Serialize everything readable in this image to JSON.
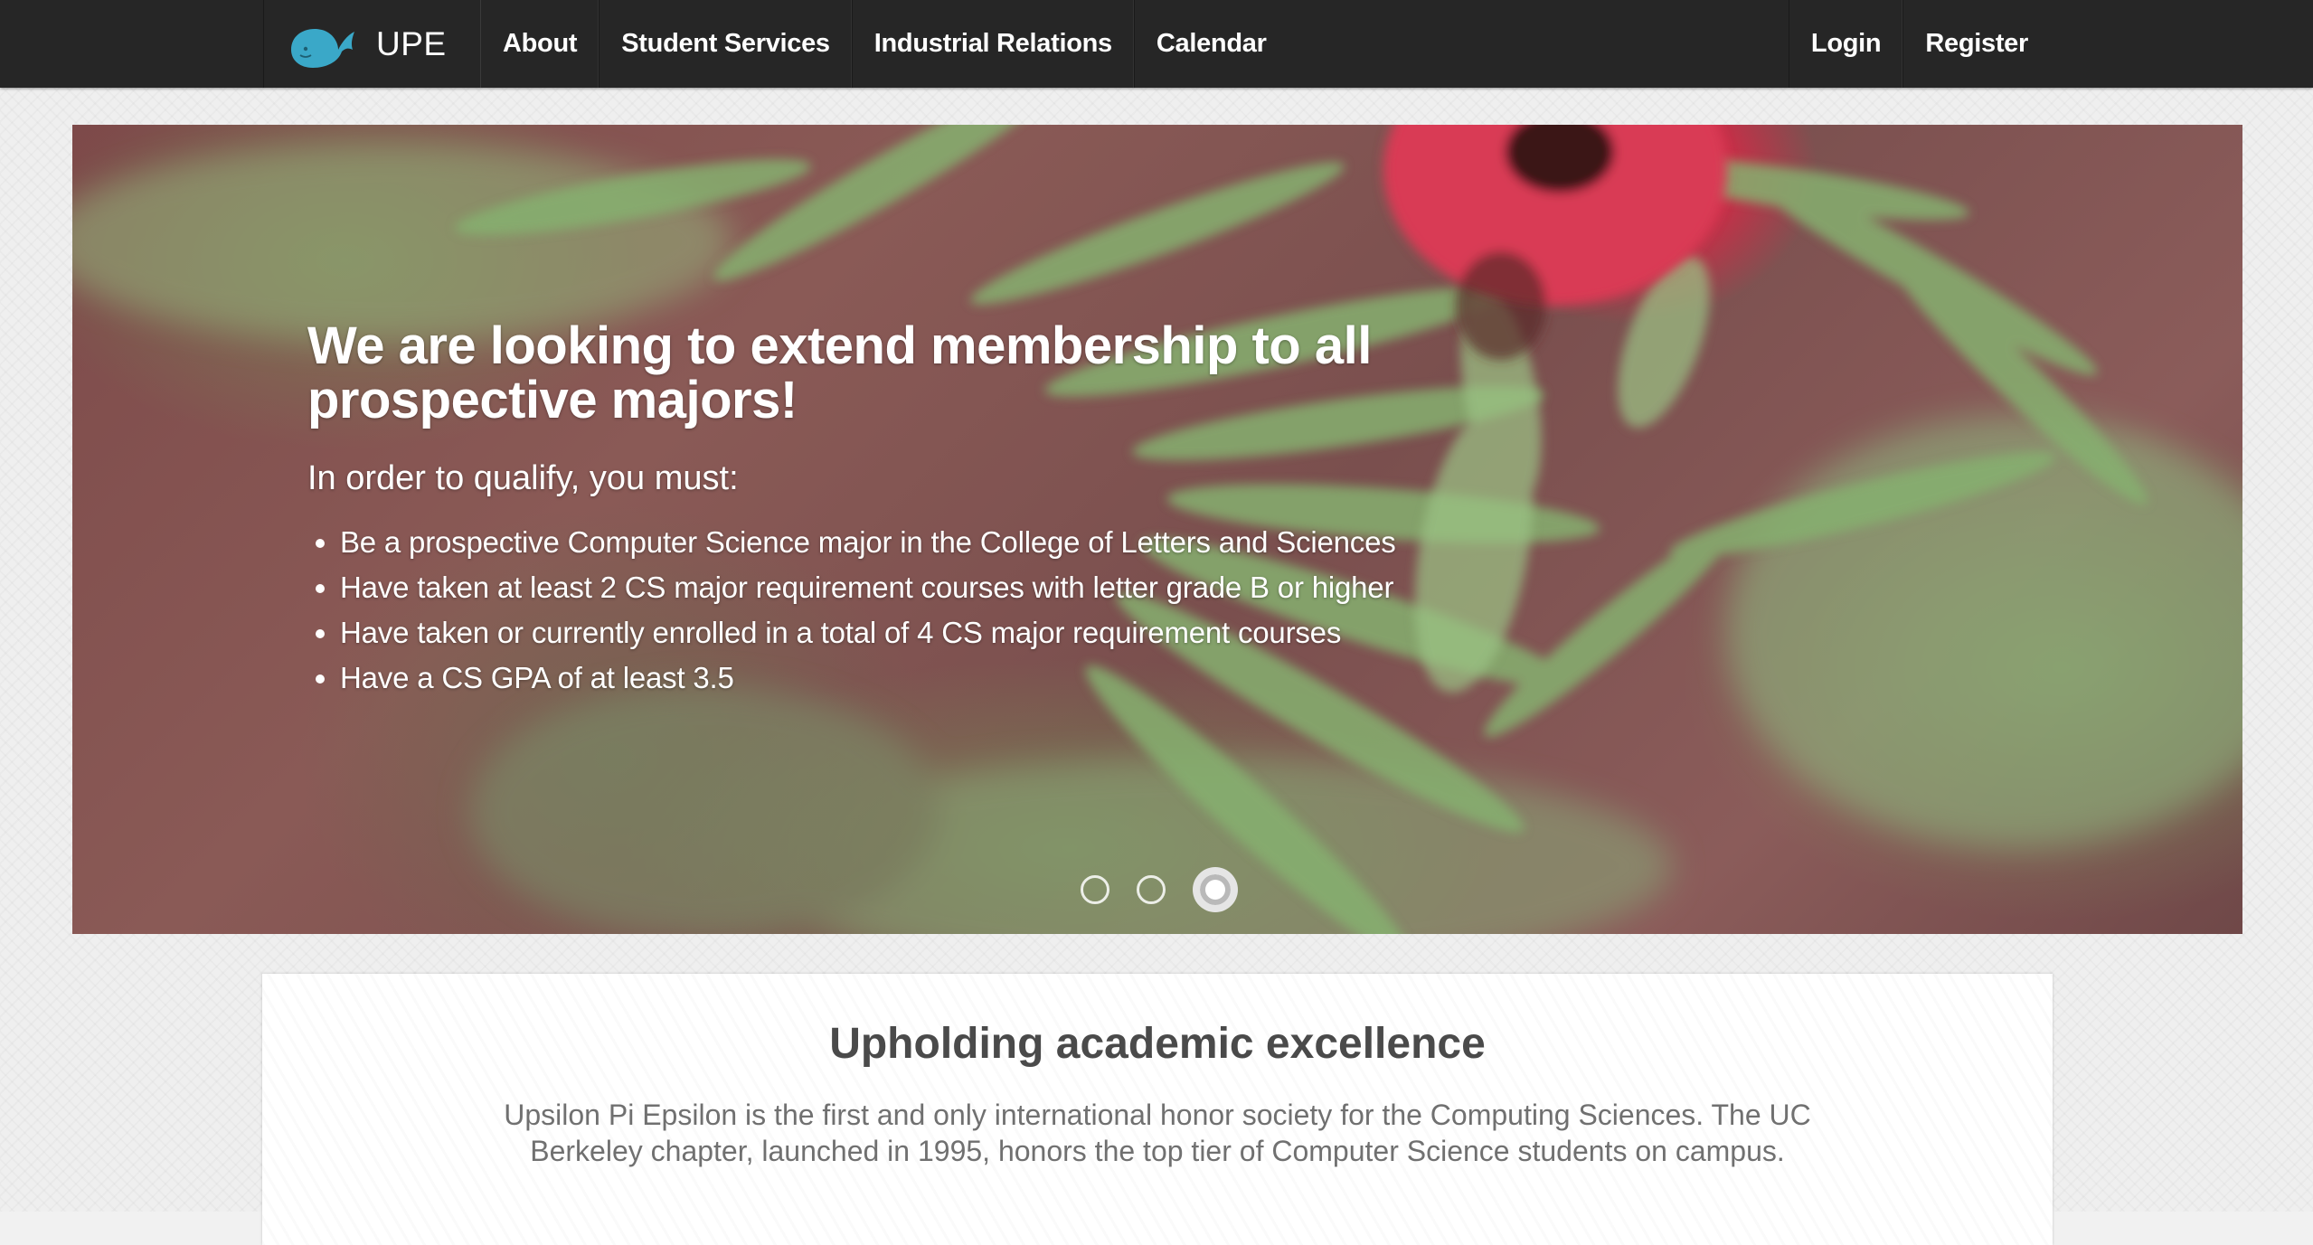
{
  "navbar": {
    "brand": "UPE",
    "logo_icon": "whale-icon",
    "left_items": [
      {
        "label": "About"
      },
      {
        "label": "Student Services"
      },
      {
        "label": "Industrial Relations"
      },
      {
        "label": "Calendar"
      }
    ],
    "right_items": [
      {
        "label": "Login"
      },
      {
        "label": "Register"
      }
    ]
  },
  "hero": {
    "title": "We are looking to extend membership to all prospective majors!",
    "subtitle": "In order to qualify, you must:",
    "requirements": [
      "Be a prospective Computer Science major in the College of Letters and Sciences",
      "Have taken at least 2 CS major requirement courses with letter grade B or higher",
      "Have taken or currently enrolled in a total of 4 CS major requirement courses",
      "Have a CS GPA of at least 3.5"
    ],
    "slides_count": 3,
    "active_slide": 3
  },
  "main": {
    "title": "Upholding academic excellence",
    "description": "Upsilon Pi Epsilon is the first and only international honor society for the Computing Sciences. The UC Berkeley chapter, launched in 1995, honors the top tier of Computer Science students on campus."
  },
  "colors": {
    "navbar_bg": "#262626",
    "logo_blue": "#3aa8c8",
    "card_title": "#4a4a4a",
    "card_text": "#707070"
  }
}
